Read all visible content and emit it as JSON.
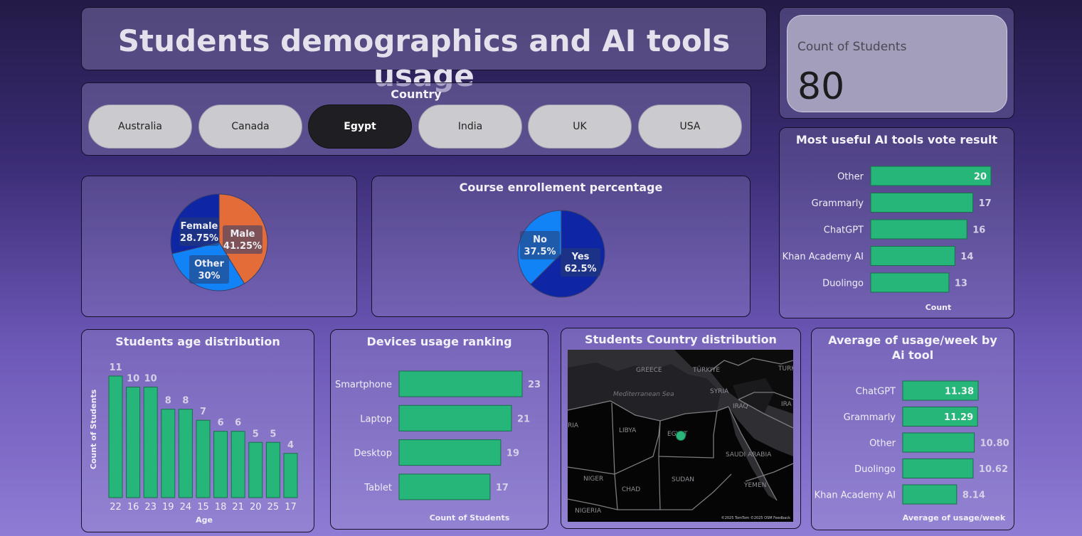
{
  "title": "Students demographics and AI tools usage",
  "country_slicer": {
    "label": "Country",
    "options": [
      "Australia",
      "Canada",
      "Egypt",
      "India",
      "UK",
      "USA"
    ],
    "selected": "Egypt"
  },
  "kpi": {
    "label": "Count of Students",
    "value": "80"
  },
  "map": {
    "title": "Students Country distribution",
    "labels": [
      "GREECE",
      "TÜRKIYE",
      "TURK",
      "SYRIA",
      "IRAQ",
      "IRA",
      "Mediterranean Sea",
      "LIBYA",
      "EGYPT",
      "SAUDI ARABIA",
      "RIA",
      "NIGER",
      "CHAD",
      "SUDAN",
      "YEMEN",
      "NIGERIA"
    ],
    "attribution": "©2025 TomTom ©2025 OSM Feedback",
    "bubble_color": "#2bb57a"
  },
  "colors": {
    "bar": "#26b67a",
    "pie_dark": "#0f26a4",
    "pie_light": "#1283f6",
    "pie_orange": "#e46c38"
  },
  "chart_data": [
    {
      "type": "pie",
      "title": "",
      "slices": [
        {
          "label": "Male",
          "value": 41.25,
          "text": "41.25%"
        },
        {
          "label": "Other",
          "value": 30,
          "text": "30%"
        },
        {
          "label": "Female",
          "value": 28.75,
          "text": "28.75%"
        }
      ]
    },
    {
      "type": "pie",
      "title": "Course enrollement percentage",
      "slices": [
        {
          "label": "Yes",
          "value": 62.5,
          "text": "62.5%"
        },
        {
          "label": "No",
          "value": 37.5,
          "text": "37.5%"
        }
      ]
    },
    {
      "type": "bar",
      "orientation": "horizontal",
      "title": "Most useful AI tools vote result",
      "categories": [
        "Other",
        "Grammarly",
        "ChatGPT",
        "Khan Academy AI",
        "Duolingo"
      ],
      "values": [
        20,
        17,
        16,
        14,
        13
      ],
      "labels": [
        "20",
        "17",
        "16",
        "14",
        "13"
      ],
      "xlabel": "Count",
      "xlim": [
        0,
        20
      ]
    },
    {
      "type": "bar",
      "title": "Students age distribution",
      "categories": [
        "22",
        "16",
        "23",
        "19",
        "24",
        "15",
        "18",
        "21",
        "20",
        "25",
        "17"
      ],
      "values": [
        11,
        10,
        10,
        8,
        8,
        7,
        6,
        6,
        5,
        5,
        4
      ],
      "labels": [
        "11",
        "10",
        "10",
        "8",
        "8",
        "7",
        "6",
        "6",
        "5",
        "5",
        "4"
      ],
      "xlabel": "Age",
      "ylabel": "Count of Students",
      "ylim": [
        0,
        11
      ]
    },
    {
      "type": "bar",
      "orientation": "horizontal",
      "title": "Devices usage ranking",
      "categories": [
        "Smartphone",
        "Laptop",
        "Desktop",
        "Tablet"
      ],
      "values": [
        23,
        21,
        19,
        17
      ],
      "labels": [
        "23",
        "21",
        "19",
        "17"
      ],
      "xlabel": "Count of Students",
      "xlim": [
        0,
        23
      ]
    },
    {
      "type": "bar",
      "orientation": "horizontal",
      "title": "Average of usage/week by Ai tool",
      "categories": [
        "ChatGPT",
        "Grammarly",
        "Other",
        "Duolingo",
        "Khan Academy AI"
      ],
      "values": [
        11.38,
        11.29,
        10.8,
        10.62,
        8.14
      ],
      "labels": [
        "11.38",
        "11.29",
        "10.80",
        "10.62",
        "8.14"
      ],
      "xlabel": "Average of usage/week",
      "xlim": [
        0,
        11.38
      ]
    }
  ]
}
